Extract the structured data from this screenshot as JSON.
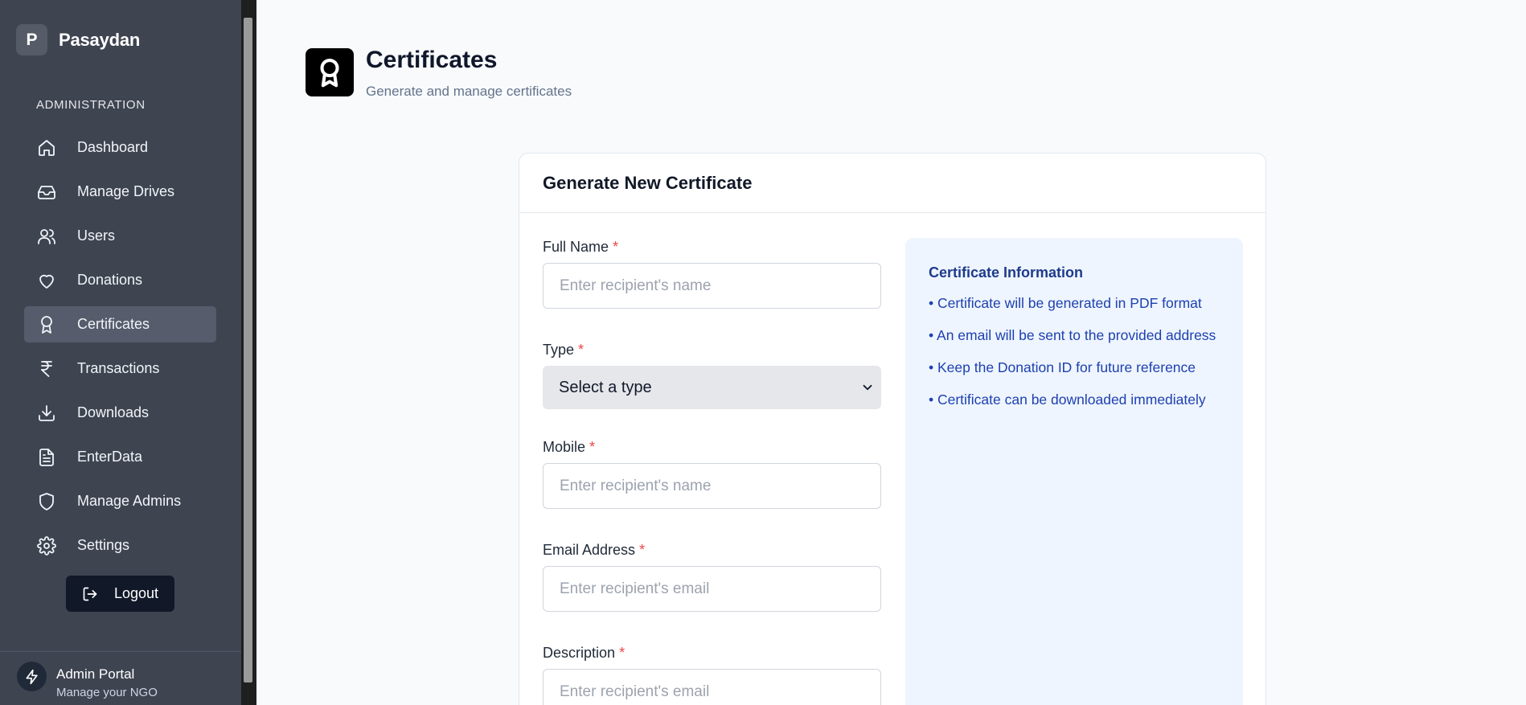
{
  "sidebar": {
    "brand": {
      "logo_letter": "P",
      "name": "Pasaydan"
    },
    "section_label": "ADMINISTRATION",
    "items": [
      {
        "label": "Dashboard",
        "icon": "home-icon"
      },
      {
        "label": "Manage Drives",
        "icon": "inbox-icon"
      },
      {
        "label": "Users",
        "icon": "users-icon"
      },
      {
        "label": "Donations",
        "icon": "heart-icon"
      },
      {
        "label": "Certificates",
        "icon": "award-icon",
        "active": true
      },
      {
        "label": "Transactions",
        "icon": "rupee-icon"
      },
      {
        "label": "Downloads",
        "icon": "download-icon"
      },
      {
        "label": "EnterData",
        "icon": "file-text-icon"
      },
      {
        "label": "Manage Admins",
        "icon": "shield-icon"
      },
      {
        "label": "Settings",
        "icon": "gear-icon"
      }
    ],
    "logout_label": "Logout",
    "footer": {
      "title": "Admin Portal",
      "subtitle": "Manage your NGO"
    }
  },
  "header": {
    "title": "Certificates",
    "subtitle": "Generate and manage certificates"
  },
  "card": {
    "title": "Generate New Certificate",
    "fields": {
      "full_name": {
        "label": "Full Name",
        "required": "*",
        "value": "",
        "placeholder": "Enter recipient's name"
      },
      "type": {
        "label": "Type",
        "required": "*",
        "selected": "Select a type"
      },
      "mobile": {
        "label": "Mobile",
        "required": "*",
        "value": "",
        "placeholder": "Enter recipient's name"
      },
      "email": {
        "label": "Email Address",
        "required": "*",
        "value": "",
        "placeholder": "Enter recipient's email"
      },
      "description": {
        "label": "Description",
        "required": "*",
        "value": "",
        "placeholder": "Enter recipient's email"
      }
    },
    "info": {
      "title": "Certificate Information",
      "items": [
        "• Certificate will be generated in PDF format",
        "• An email will be sent to the provided address",
        "• Keep the Donation ID for future reference",
        "• Certificate can be downloaded immediately"
      ]
    }
  },
  "colors": {
    "sidebar_bg": "#3f4451",
    "active_item_bg": "#565c6b",
    "required": "#ef4444",
    "info_bg": "#eef5ff",
    "info_text": "#1e40af"
  }
}
